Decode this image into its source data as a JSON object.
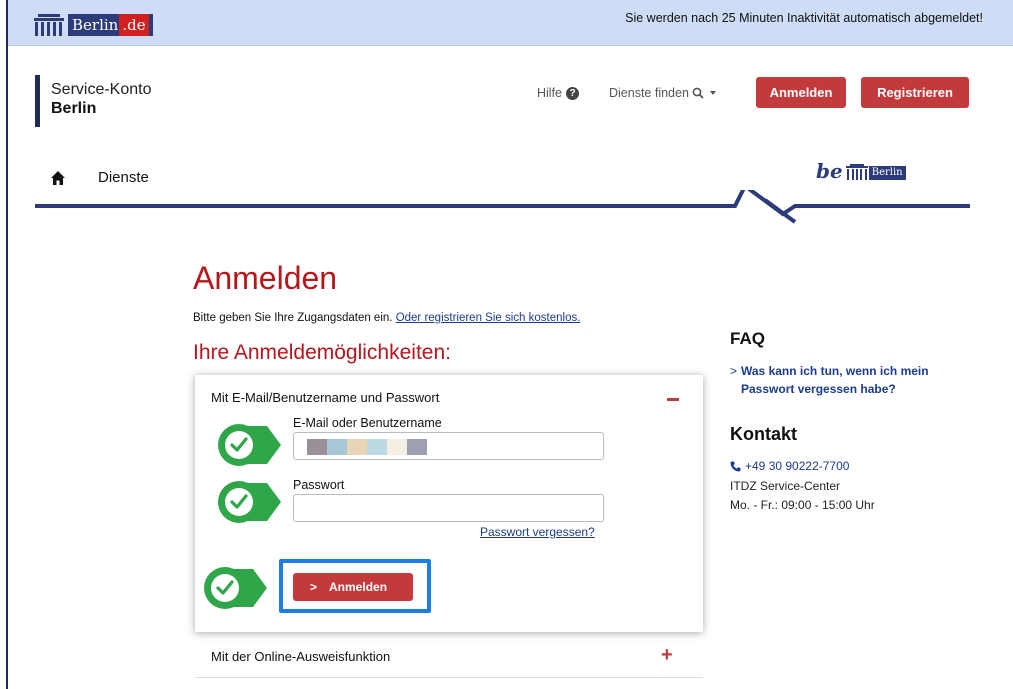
{
  "topbar": {
    "logo_text": "Berlin",
    "logo_suffix": ".de",
    "inactivity_notice": "Sie werden nach 25 Minuten Inaktivität automatisch abgemeldet!"
  },
  "header": {
    "brand_line1": "Service-Konto",
    "brand_line2": "Berlin",
    "help_label": "Hilfe",
    "find_services_label": "Dienste finden",
    "login_label": "Anmelden",
    "register_label": "Registrieren"
  },
  "nav": {
    "services_label": "Dienste",
    "be_logo_text": "be",
    "be_logo_box": "Berlin"
  },
  "main": {
    "title": "Anmelden",
    "intro_text": "Bitte geben Sie Ihre Zugangsdaten ein.",
    "intro_link": "Oder registrieren Sie sich kostenlos.",
    "options_heading": "Ihre Anmeldemöglichkeiten:",
    "panel": {
      "title": "Mit E-Mail/Benutzername und Passwort",
      "username_label": "E-Mail oder Benutzername",
      "username_value_blocks": [
        "#9b8f9a",
        "#a6c7d8",
        "#e8d5b5",
        "#bcd8e2",
        "#f5efe3",
        "#9ea0b2"
      ],
      "password_label": "Passwort",
      "password_value": "",
      "forgot_password": "Passwort vergessen?",
      "submit_label": "Anmelden"
    },
    "ausweis_label": "Mit der Online-Ausweisfunktion"
  },
  "sidebar": {
    "faq_heading": "FAQ",
    "faq_link": "Was kann ich tun, wenn ich mein Passwort vergessen habe?",
    "contact_heading": "Kontakt",
    "phone": "+49 30 90222-7700",
    "service_center": "ITDZ Service-Center",
    "hours": "Mo. - Fr.: 09:00 - 15:00 Uhr"
  },
  "colors": {
    "accent_red": "#c33a3d",
    "heading_red": "#b5171d",
    "navy": "#1f2a55",
    "link_blue": "#1b3b8f",
    "check_green": "#2fa64a",
    "highlight_blue": "#1f7de6"
  }
}
